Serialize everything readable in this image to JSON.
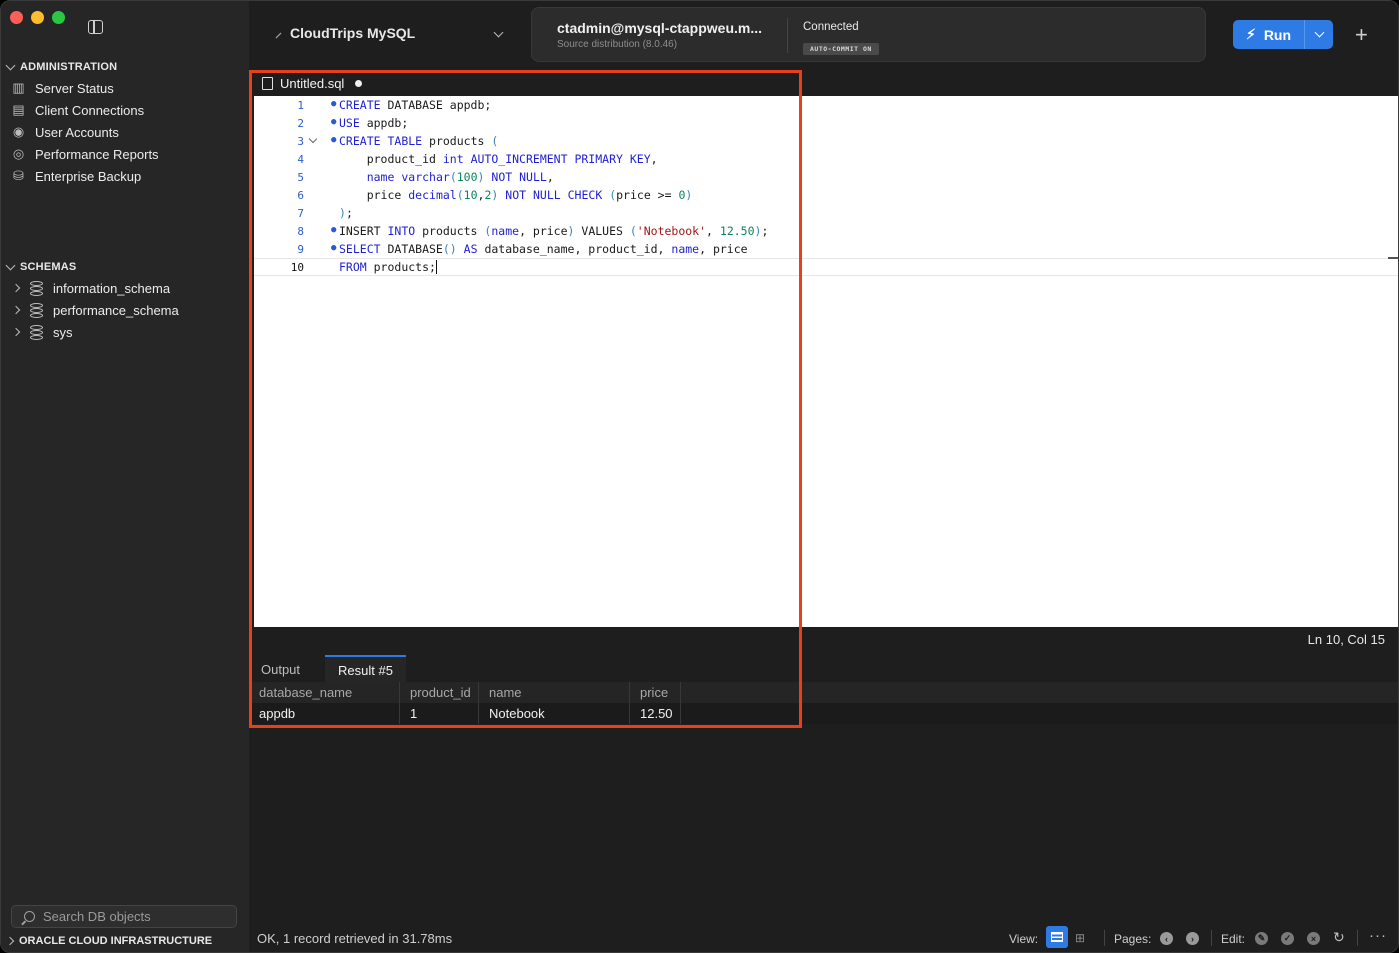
{
  "sidebar": {
    "administration_label": "ADMINISTRATION",
    "admin_items": [
      {
        "label": "Server Status",
        "icon": "server-icon"
      },
      {
        "label": "Client Connections",
        "icon": "connections-icon"
      },
      {
        "label": "User Accounts",
        "icon": "user-icon"
      },
      {
        "label": "Performance Reports",
        "icon": "gauge-icon"
      },
      {
        "label": "Enterprise Backup",
        "icon": "backup-icon"
      }
    ],
    "schemas_label": "SCHEMAS",
    "schemas": [
      {
        "label": "information_schema"
      },
      {
        "label": "performance_schema"
      },
      {
        "label": "sys"
      }
    ],
    "search_placeholder": "Search DB objects",
    "oci_label": "ORACLE CLOUD INFRASTRUCTURE"
  },
  "toolbar": {
    "connection_name": "CloudTrips MySQL",
    "connection_user": "ctadmin@mysql-ctappweu.m...",
    "connection_sub": "Source distribution (8.0.46)",
    "status": "Connected",
    "autocommit": "AUTO-COMMIT ON",
    "run_label": "Run",
    "run_icon": "lightning-icon"
  },
  "editor": {
    "tab_name": "Untitled.sql",
    "cursor_position": "Ln 10, Col 15",
    "lines": [
      {
        "n": "1",
        "text": "CREATE DATABASE appdb;"
      },
      {
        "n": "2",
        "text": "USE appdb;"
      },
      {
        "n": "3",
        "text": "CREATE TABLE products ("
      },
      {
        "n": "4",
        "text": "    product_id int AUTO_INCREMENT PRIMARY KEY,"
      },
      {
        "n": "5",
        "text": "    name varchar(100) NOT NULL,"
      },
      {
        "n": "6",
        "text": "    price decimal(10,2) NOT NULL CHECK (price >= 0)"
      },
      {
        "n": "7",
        "text": ");"
      },
      {
        "n": "8",
        "text": "INSERT INTO products (name, price) VALUES ('Notebook', 12.50);"
      },
      {
        "n": "9",
        "text": "SELECT DATABASE() AS database_name, product_id, name, price"
      },
      {
        "n": "10",
        "text": "FROM products;"
      }
    ]
  },
  "results": {
    "tabs": [
      "Output",
      "Result #5"
    ],
    "active_tab": "Result #5",
    "columns": [
      "database_name",
      "product_id",
      "name",
      "price"
    ],
    "rows": [
      [
        "appdb",
        "1",
        "Notebook",
        "12.50"
      ]
    ]
  },
  "statusbar": {
    "message": "OK, 1 record retrieved in 31.78ms",
    "view_label": "View:",
    "pages_label": "Pages:",
    "edit_label": "Edit:"
  },
  "colors": {
    "accent": "#2f7be6",
    "highlight": "#e8401c"
  }
}
